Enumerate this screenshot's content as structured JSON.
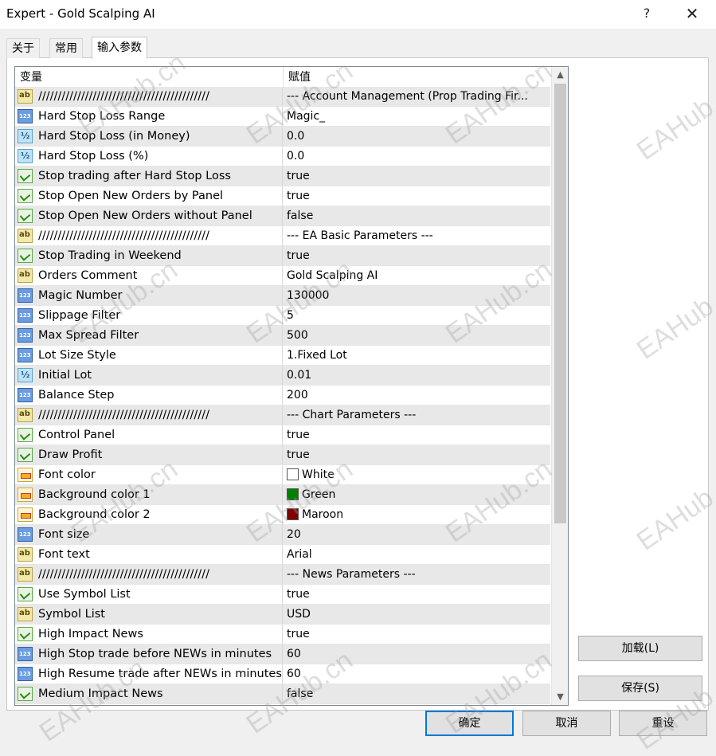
{
  "window": {
    "title": "Expert - Gold Scalping AI",
    "help_glyph": "?",
    "close_glyph": "✕"
  },
  "tabs": [
    {
      "label": "关于"
    },
    {
      "label": "常用"
    },
    {
      "label": "输入参数"
    }
  ],
  "grid": {
    "col_variable": "变量",
    "col_value": "赋值",
    "rows": [
      {
        "icon": "ab",
        "name": "////////////////////////////////////////////",
        "value": "--- Account Management (Prop Trading Fir..."
      },
      {
        "icon": "int",
        "name": "Hard Stop Loss Range",
        "value": "Magic_"
      },
      {
        "icon": "double",
        "name": "Hard Stop Loss (in Money)",
        "value": "0.0"
      },
      {
        "icon": "double",
        "name": "Hard Stop Loss (%)",
        "value": "0.0"
      },
      {
        "icon": "bool",
        "name": "Stop trading after Hard Stop Loss",
        "value": "true"
      },
      {
        "icon": "bool",
        "name": "Stop Open New Orders by Panel",
        "value": "true"
      },
      {
        "icon": "bool",
        "name": "Stop Open New Orders without Panel",
        "value": "false"
      },
      {
        "icon": "ab",
        "name": "////////////////////////////////////////////",
        "value": "--- EA Basic Parameters ---"
      },
      {
        "icon": "bool",
        "name": "Stop Trading in Weekend",
        "value": "true"
      },
      {
        "icon": "ab",
        "name": "Orders Comment",
        "value": "Gold Scalping AI"
      },
      {
        "icon": "int",
        "name": "Magic Number",
        "value": "130000"
      },
      {
        "icon": "int",
        "name": "Slippage Filter",
        "value": "5"
      },
      {
        "icon": "int",
        "name": "Max Spread Filter",
        "value": "500"
      },
      {
        "icon": "int",
        "name": "Lot Size Style",
        "value": "1.Fixed Lot"
      },
      {
        "icon": "double",
        "name": "Initial Lot",
        "value": "0.01"
      },
      {
        "icon": "int",
        "name": "Balance Step",
        "value": "200"
      },
      {
        "icon": "ab",
        "name": "////////////////////////////////////////////",
        "value": "--- Chart Parameters ---"
      },
      {
        "icon": "bool",
        "name": "Control Panel",
        "value": "true"
      },
      {
        "icon": "bool",
        "name": "Draw Profit",
        "value": "true"
      },
      {
        "icon": "color",
        "name": "Font color",
        "value": "White",
        "swatch": "#ffffff"
      },
      {
        "icon": "color",
        "name": "Background color 1",
        "value": "Green",
        "swatch": "#008000"
      },
      {
        "icon": "color",
        "name": "Background color 2",
        "value": "Maroon",
        "swatch": "#800000"
      },
      {
        "icon": "int",
        "name": "Font size",
        "value": "20"
      },
      {
        "icon": "ab",
        "name": "Font text",
        "value": "Arial"
      },
      {
        "icon": "ab",
        "name": "////////////////////////////////////////////",
        "value": "--- News Parameters ---"
      },
      {
        "icon": "bool",
        "name": "Use Symbol List",
        "value": "true"
      },
      {
        "icon": "ab",
        "name": "Symbol List",
        "value": "USD"
      },
      {
        "icon": "bool",
        "name": "High Impact News",
        "value": "true"
      },
      {
        "icon": "int",
        "name": "High Stop trade before NEWs in minutes",
        "value": "60"
      },
      {
        "icon": "int",
        "name": "High Resume trade after NEWs in minutes",
        "value": "60"
      },
      {
        "icon": "bool",
        "name": "Medium Impact News",
        "value": "false"
      }
    ]
  },
  "scroll": {
    "up_glyph": "▲",
    "down_glyph": "▼"
  },
  "buttons": {
    "load": "加载(L)",
    "save": "保存(S)",
    "ok": "确定",
    "cancel": "取消",
    "reset": "重设"
  },
  "watermark": "EAHub.cn",
  "colors": {
    "accent": "#0078d7",
    "row_alt": "#e8e8e8"
  }
}
